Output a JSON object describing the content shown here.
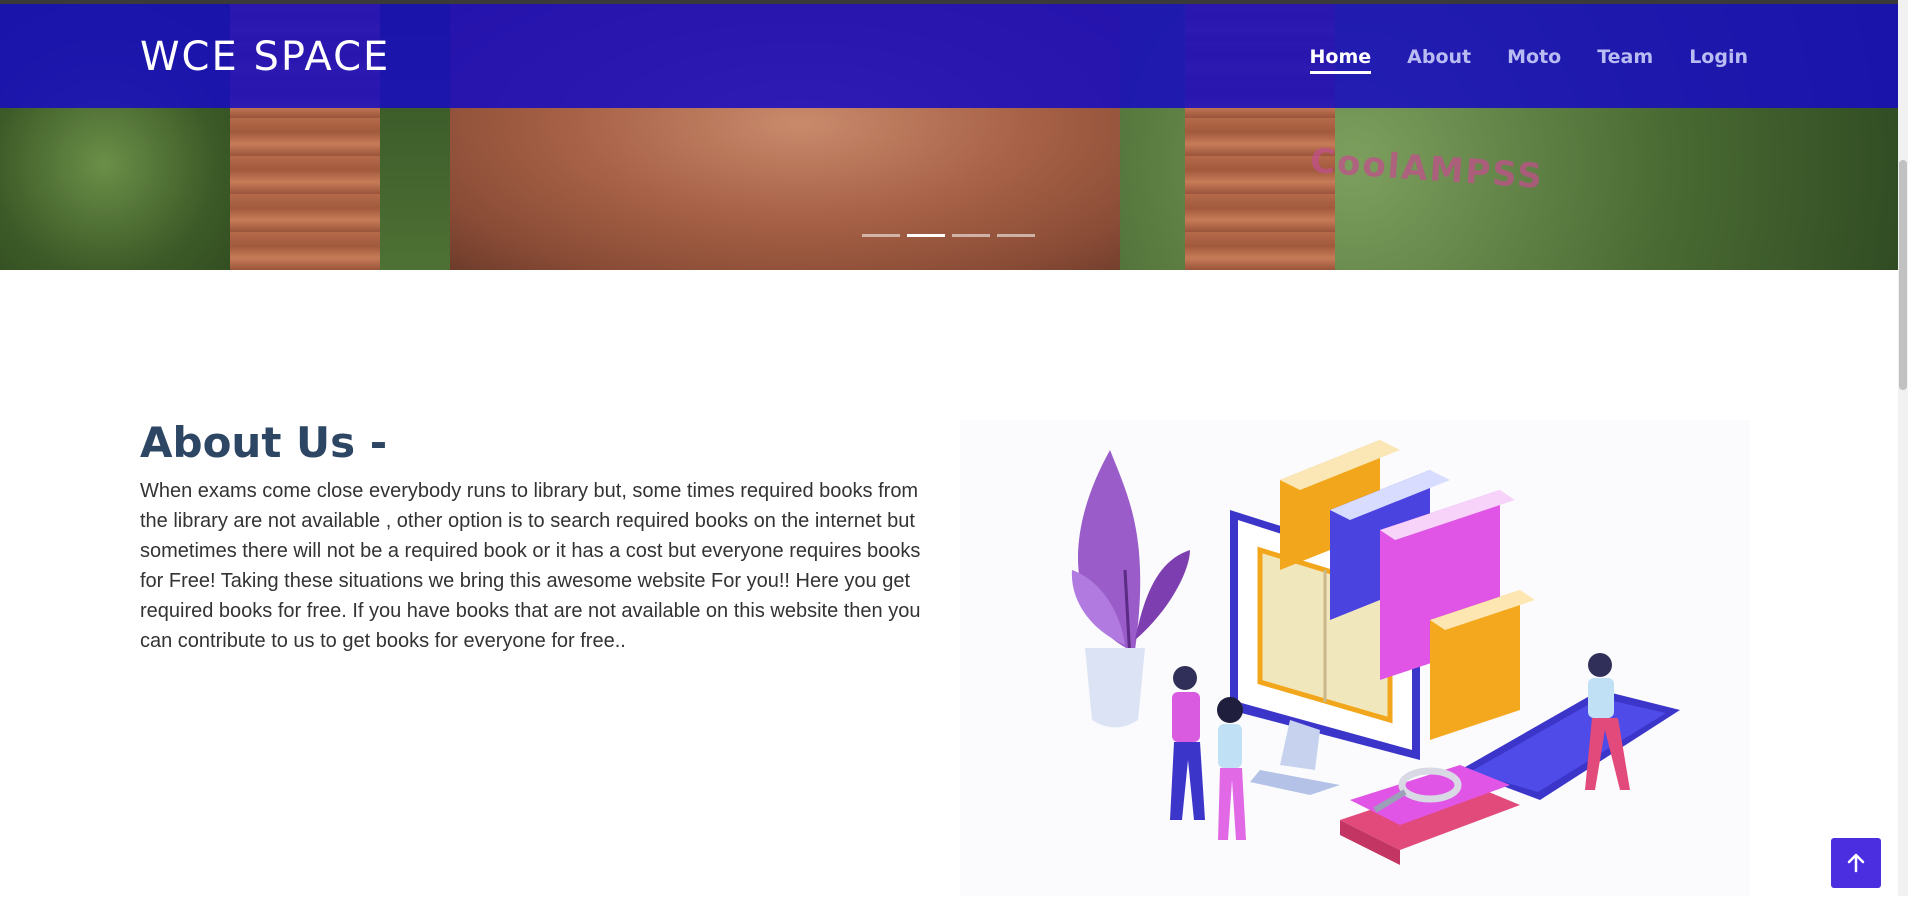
{
  "site": {
    "logo": "WCE SPACE"
  },
  "nav": {
    "items": [
      {
        "label": "Home",
        "active": true
      },
      {
        "label": "About",
        "active": false
      },
      {
        "label": "Moto",
        "active": false
      },
      {
        "label": "Team",
        "active": false
      },
      {
        "label": "Login",
        "active": false
      }
    ]
  },
  "hero": {
    "watermark": "CoolAMPSS",
    "slides": 4,
    "active_slide": 2
  },
  "about": {
    "title": "About Us -",
    "text": "When exams come close everybody runs to library but, some times required books from the library are not available , other option is to search required books on the internet but sometimes there will not be a required book or it has a cost but everyone requires books for Free! Taking these situations we bring this awesome website For you!! Here you get required books for free. If you have books that are not available on this website then you can contribute to us to get books for everyone for free..",
    "illustration_icon": "books-library-illustration"
  },
  "back_to_top": {
    "icon": "arrow-up-icon"
  },
  "colors": {
    "header_bg": "#1a0cbe",
    "nav_active": "#ffffff",
    "nav_inactive": "#b9bcf2",
    "title": "#2c4664",
    "body_text": "#333333",
    "back_to_top_bg": "#4b2ee0"
  }
}
